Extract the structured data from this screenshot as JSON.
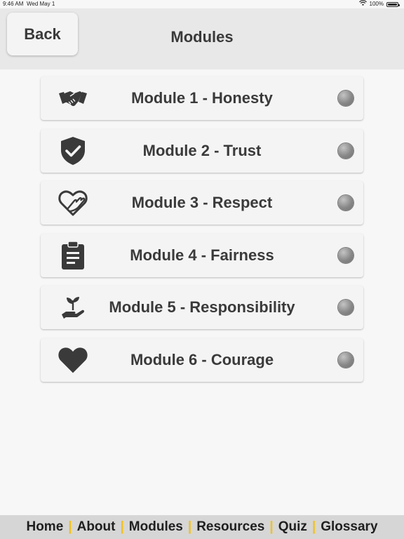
{
  "status_bar": {
    "time": "9:46 AM",
    "date": "Wed May 1",
    "battery": "100%"
  },
  "header": {
    "back_label": "Back",
    "title": "Modules"
  },
  "modules": [
    {
      "label": "Module 1 - Honesty",
      "icon": "handshake-icon"
    },
    {
      "label": "Module 2 - Trust",
      "icon": "shield-check-icon"
    },
    {
      "label": "Module 3 - Respect",
      "icon": "heart-hand-icon"
    },
    {
      "label": "Module 4 - Fairness",
      "icon": "clipboard-icon"
    },
    {
      "label": "Module 5 - Responsibility",
      "icon": "plant-hand-icon"
    },
    {
      "label": "Module 6 - Courage",
      "icon": "heart-icon"
    }
  ],
  "footer": {
    "items": [
      "Home",
      "About",
      "Modules",
      "Resources",
      "Quiz",
      "Glossary"
    ],
    "separator": "|"
  },
  "colors": {
    "header_bg": "#e8e8e8",
    "footer_bg": "#d6d6d6",
    "separator": "#f2c21b",
    "text": "#3a3a3a",
    "status_dot": "#8a8a8a"
  }
}
